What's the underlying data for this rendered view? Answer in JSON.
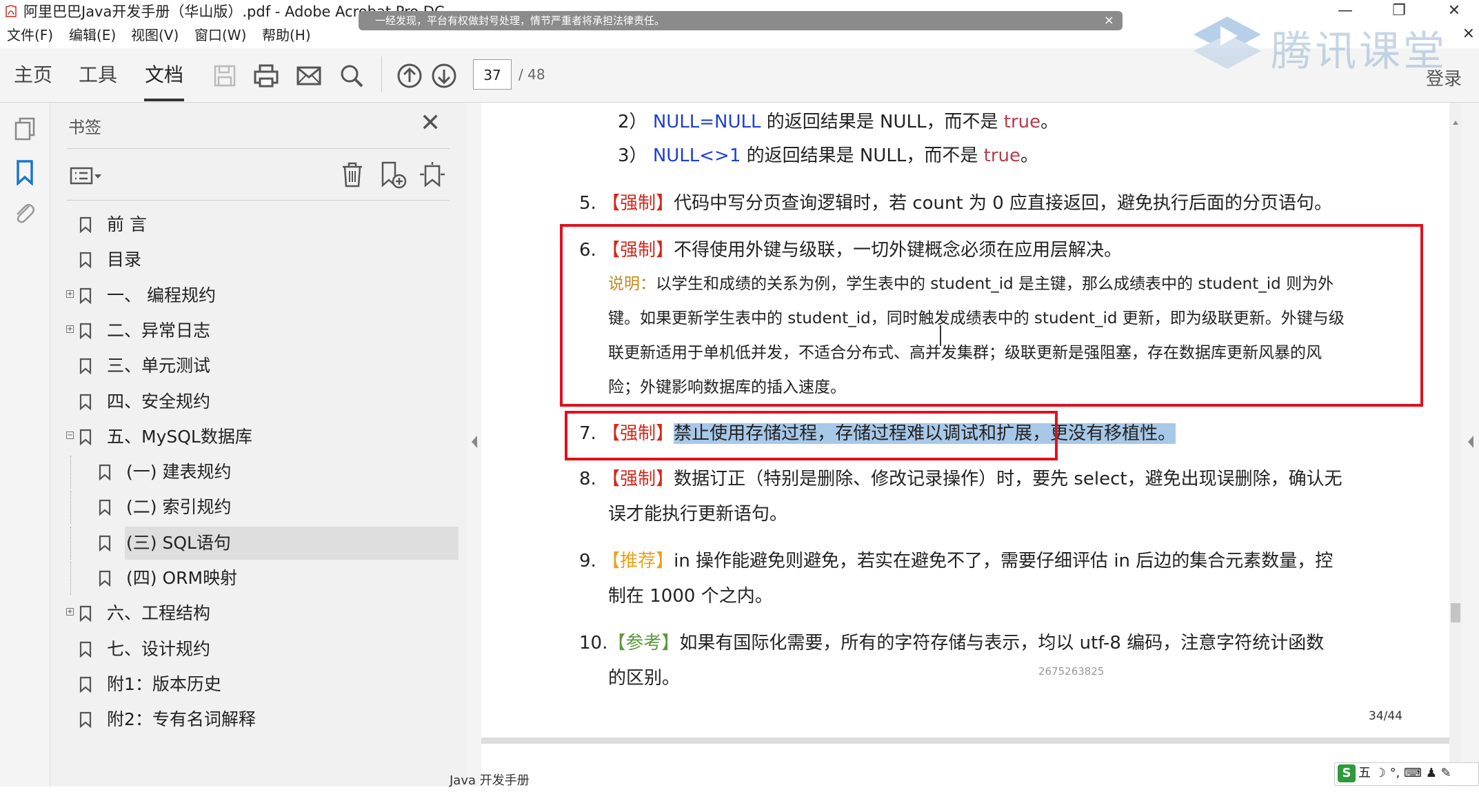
{
  "window": {
    "title": "阿里巴巴Java开发手册（华山版）.pdf - Adobe Acrobat Pro DC",
    "minimize": "—",
    "maximize": "❐",
    "close": "✕"
  },
  "notice": {
    "text": "一经发现，平台有权做封号处理，情节严重者将承担法律责任。",
    "close": "×"
  },
  "watermark_logo": {
    "text": "腾讯课堂",
    "color": "#2a7fe0"
  },
  "menubar": {
    "items": [
      "文件(F)",
      "编辑(E)",
      "视图(V)",
      "窗口(W)",
      "帮助(H)"
    ],
    "close": "×"
  },
  "toolbar": {
    "tabs": [
      "主页",
      "工具",
      "文档"
    ],
    "active_tab": "文档",
    "icons": [
      "save-icon",
      "print-icon",
      "email-icon",
      "search-icon",
      "page-up-icon",
      "page-down-icon"
    ],
    "page_number": "37",
    "page_total": "/ 48",
    "login": "登录"
  },
  "left_rail": {
    "icons": [
      "pages-icon",
      "bookmark-icon",
      "attachment-icon"
    ],
    "active": "bookmark-icon"
  },
  "bookmarks": {
    "title": "书签",
    "close": "✕",
    "items": [
      {
        "label": "前 言",
        "level": 0,
        "expander": ""
      },
      {
        "label": "目录",
        "level": 0,
        "expander": ""
      },
      {
        "label": "一、 编程规约",
        "level": 0,
        "expander": "+"
      },
      {
        "label": "二、异常日志",
        "level": 0,
        "expander": "+"
      },
      {
        "label": "三、单元测试",
        "level": 0,
        "expander": ""
      },
      {
        "label": "四、安全规约",
        "level": 0,
        "expander": ""
      },
      {
        "label": "五、MySQL数据库",
        "level": 0,
        "expander": "−"
      },
      {
        "label": "(一) 建表规约",
        "level": 1,
        "expander": ""
      },
      {
        "label": "(二) 索引规约",
        "level": 1,
        "expander": ""
      },
      {
        "label": "(三) SQL语句",
        "level": 1,
        "expander": "",
        "selected": true
      },
      {
        "label": "(四) ORM映射",
        "level": 1,
        "expander": ""
      },
      {
        "label": "六、工程结构",
        "level": 0,
        "expander": "+"
      },
      {
        "label": "七、设计规约",
        "level": 0,
        "expander": ""
      },
      {
        "label": "附1：版本历史",
        "level": 0,
        "expander": ""
      },
      {
        "label": "附2：专有名词解释",
        "level": 0,
        "expander": ""
      }
    ]
  },
  "document": {
    "sub2": {
      "num": "2）",
      "code": "NULL=NULL",
      "text": " 的返回结果是 NULL，而不是 ",
      "kw": "true",
      "end": "。"
    },
    "sub3": {
      "num": "3）",
      "code": "NULL<>1",
      "text": " 的返回结果是 NULL，而不是 ",
      "kw": "true",
      "end": "。"
    },
    "item5": {
      "num": "5.",
      "tag": "【强制】",
      "text": "代码中写分页查询逻辑时，若 count 为 0 应直接返回，避免执行后面的分页语句。"
    },
    "item6": {
      "num": "6.",
      "tag": "【强制】",
      "text": "不得使用外键与级联，一切外键概念必须在应用层解决。",
      "note_label": "说明：",
      "note_lines": [
        "以学生和成绩的关系为例，学生表中的 student_id 是主键，那么成绩表中的 student_id 则为外",
        "键。如果更新学生表中的 student_id，同时触发成绩表中的 student_id 更新，即为级联更新。外键与级",
        "联更新适用于单机低并发，不适合分布式、高并发集群；级联更新是强阻塞，存在数据库更新风暴的风",
        "险；外键影响数据库的插入速度。"
      ]
    },
    "item7": {
      "num": "7.",
      "tag": "【强制】",
      "text": "禁止使用存储过程，存储过程难以调试和扩展，更没有移植性。"
    },
    "item8": {
      "num": "8.",
      "tag": "【强制】",
      "lines": [
        "数据订正（特别是删除、修改记录操作）时，要先 select，避免出现误删除，确认无",
        "误才能执行更新语句。"
      ]
    },
    "item9": {
      "num": "9.",
      "tag": "【推荐】",
      "lines": [
        "in 操作能避免则避免，若实在避免不了，需要仔细评估 in 后边的集合元素数量，控",
        "制在 1000 个之内。"
      ]
    },
    "item10": {
      "num": "10.",
      "tag": "【参考】",
      "lines": [
        "如果有国际化需要，所有的字符存储与表示，均以 utf-8 编码，注意字符统计函数",
        "的区别。"
      ]
    },
    "watermark_id": "2675263825",
    "page_footer": "34/44",
    "next_page_header": "Java 开发手册"
  },
  "ime": {
    "text": "五 ☽ °, ⌨ ♟ ✎"
  }
}
